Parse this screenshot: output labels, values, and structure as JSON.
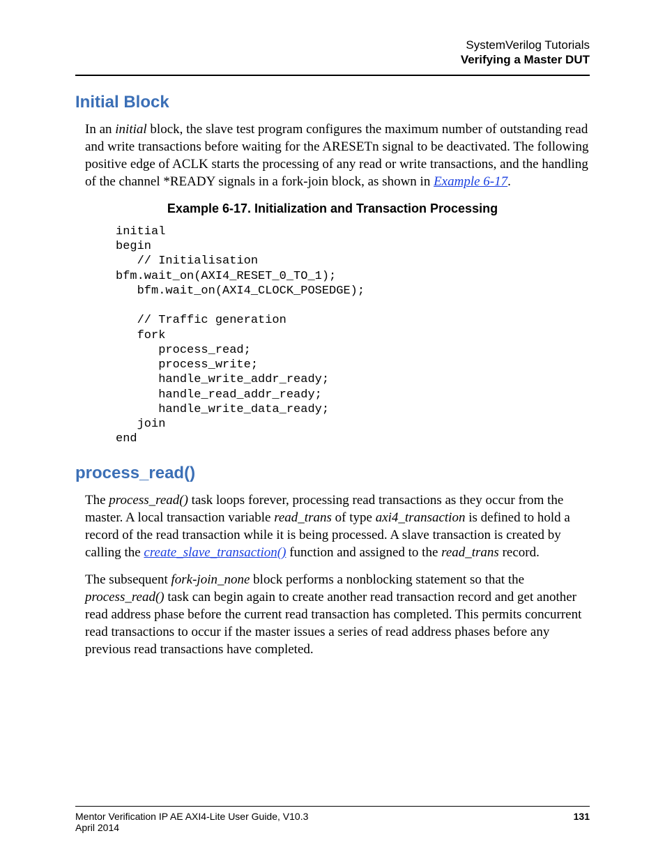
{
  "header": {
    "line1": "SystemVerilog Tutorials",
    "line2": "Verifying a Master DUT"
  },
  "sections": {
    "s1_title": "Initial Block",
    "s1_p1_a": "In an ",
    "s1_p1_b": "initial",
    "s1_p1_c": " block, the slave test program configures the maximum number of outstanding read and write transactions before waiting for the ARESETn signal to be deactivated. The following positive edge of ACLK starts the processing of any read or write transactions, and the handling of the channel *READY signals in a fork-join block, as shown in ",
    "s1_p1_link": "Example 6-17",
    "s1_p1_end": ".",
    "example_caption": "Example 6-17. Initialization and Transaction Processing",
    "code": "initial\nbegin\n   // Initialisation\nbfm.wait_on(AXI4_RESET_0_TO_1);\n   bfm.wait_on(AXI4_CLOCK_POSEDGE);\n\n   // Traffic generation\n   fork\n      process_read;\n      process_write;\n      handle_write_addr_ready;\n      handle_read_addr_ready;\n      handle_write_data_ready;\n   join\nend",
    "s2_title": "process_read()",
    "s2_p1_a": "The ",
    "s2_p1_b": "process_read()",
    "s2_p1_c": " task loops forever, processing read transactions as they occur from the master. A local transaction variable ",
    "s2_p1_d": "read_trans",
    "s2_p1_e": " of type ",
    "s2_p1_f": "axi4_transaction",
    "s2_p1_g": " is defined to hold a record of the read transaction while it is being processed. A slave transaction is created by calling the ",
    "s2_p1_link": "create_slave_transaction()",
    "s2_p1_h": " function and assigned to the ",
    "s2_p1_i": "read_trans",
    "s2_p1_j": " record.",
    "s2_p2_a": "The subsequent ",
    "s2_p2_b": "fork-join_none",
    "s2_p2_c": " block performs a nonblocking statement so that the ",
    "s2_p2_d": "process_read()",
    "s2_p2_e": " task can begin again to create another read transaction record and get another read address phase before the current read transaction has completed. This permits concurrent read transactions to occur if the master issues a series of read address phases before any previous read transactions have completed."
  },
  "footer": {
    "doc": "Mentor Verification IP AE AXI4-Lite User Guide, V10.3",
    "date": "April 2014",
    "page": "131"
  }
}
